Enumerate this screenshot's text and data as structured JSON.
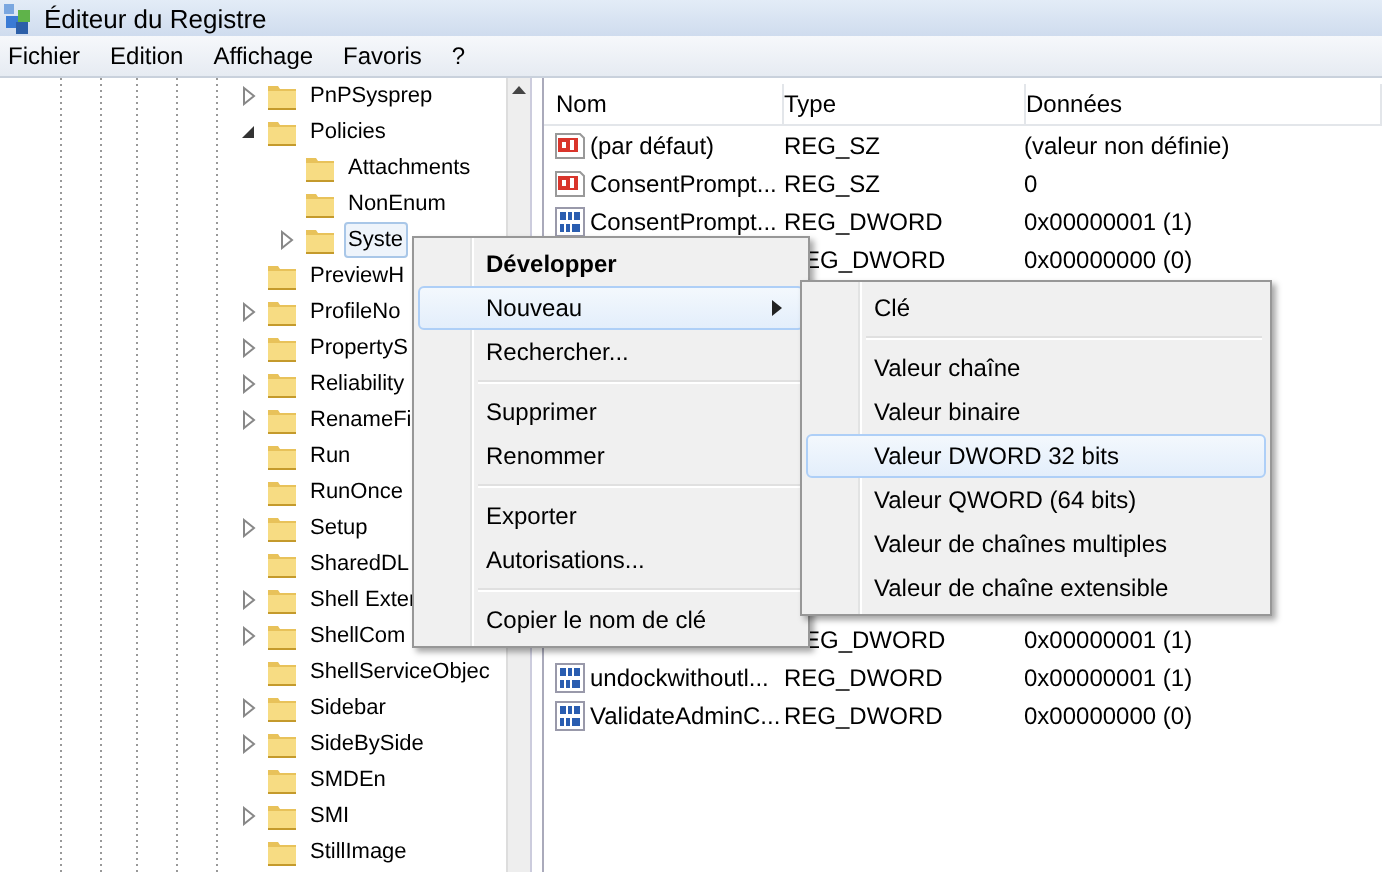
{
  "window": {
    "title": "Éditeur du Registre"
  },
  "menu_bar": [
    "Fichier",
    "Edition",
    "Affichage",
    "Favoris",
    "?"
  ],
  "tree": [
    {
      "label": "PnPSysprep",
      "expandable": true,
      "expanded": false,
      "selected": false
    },
    {
      "label": "Policies",
      "expandable": true,
      "expanded": true,
      "selected": false,
      "children": [
        {
          "label": "Attachments",
          "expandable": false,
          "selected": false
        },
        {
          "label": "NonEnum",
          "expandable": false,
          "selected": false
        },
        {
          "label": "Syste",
          "expandable": true,
          "expanded": false,
          "selected": true
        }
      ]
    },
    {
      "label": "PreviewH",
      "expandable": false,
      "selected": false
    },
    {
      "label": "ProfileNo",
      "expandable": true,
      "expanded": false,
      "selected": false
    },
    {
      "label": "PropertyS",
      "expandable": true,
      "expanded": false,
      "selected": false
    },
    {
      "label": "Reliability",
      "expandable": true,
      "expanded": false,
      "selected": false
    },
    {
      "label": "RenameFi",
      "expandable": true,
      "expanded": false,
      "selected": false
    },
    {
      "label": "Run",
      "expandable": false,
      "selected": false
    },
    {
      "label": "RunOnce",
      "expandable": false,
      "selected": false
    },
    {
      "label": "Setup",
      "expandable": true,
      "expanded": false,
      "selected": false
    },
    {
      "label": "SharedDL",
      "expandable": false,
      "selected": false
    },
    {
      "label": "Shell Exter",
      "expandable": true,
      "expanded": false,
      "selected": false
    },
    {
      "label": "ShellCom",
      "expandable": true,
      "expanded": false,
      "selected": false
    },
    {
      "label": "ShellServiceObjec",
      "expandable": false,
      "selected": false
    },
    {
      "label": "Sidebar",
      "expandable": true,
      "expanded": false,
      "selected": false
    },
    {
      "label": "SideBySide",
      "expandable": true,
      "expanded": false,
      "selected": false
    },
    {
      "label": "SMDEn",
      "expandable": false,
      "selected": false
    },
    {
      "label": "SMI",
      "expandable": true,
      "expanded": false,
      "selected": false
    },
    {
      "label": "StillImage",
      "expandable": false,
      "selected": false
    }
  ],
  "values": {
    "columns": [
      "Nom",
      "Type",
      "Données"
    ],
    "rows_top": [
      {
        "kind": "string",
        "name": "(par défaut)",
        "type": "REG_SZ",
        "data": "(valeur non définie)"
      },
      {
        "kind": "string",
        "name": "ConsentPrompt...",
        "type": "REG_SZ",
        "data": "0"
      },
      {
        "kind": "dword",
        "name": "ConsentPrompt...",
        "type": "REG_DWORD",
        "data": "0x00000001 (1)"
      },
      {
        "kind": "hidden",
        "type": "EG_DWORD",
        "data": "0x00000000 (0)"
      }
    ],
    "rows_bottom": [
      {
        "kind": "hidden",
        "type": "EG_DWORD",
        "data": "0x00000001 (1)"
      },
      {
        "kind": "dword",
        "name": "undockwithoutl...",
        "type": "REG_DWORD",
        "data": "0x00000001 (1)"
      },
      {
        "kind": "dword",
        "name": "ValidateAdminC...",
        "type": "REG_DWORD",
        "data": "0x00000000 (0)"
      }
    ]
  },
  "context_menu": [
    {
      "kind": "item",
      "label": "Développer",
      "default": true,
      "selected": false,
      "submenu": false
    },
    {
      "kind": "item",
      "label": "Nouveau",
      "default": false,
      "selected": true,
      "submenu": true
    },
    {
      "kind": "item",
      "label": "Rechercher...",
      "default": false,
      "selected": false,
      "submenu": false
    },
    {
      "kind": "separator"
    },
    {
      "kind": "item",
      "label": "Supprimer",
      "default": false,
      "selected": false,
      "submenu": false
    },
    {
      "kind": "item",
      "label": "Renommer",
      "default": false,
      "selected": false,
      "submenu": false
    },
    {
      "kind": "separator"
    },
    {
      "kind": "item",
      "label": "Exporter",
      "default": false,
      "selected": false,
      "submenu": false
    },
    {
      "kind": "item",
      "label": "Autorisations...",
      "default": false,
      "selected": false,
      "submenu": false
    },
    {
      "kind": "separator"
    },
    {
      "kind": "item",
      "label": "Copier le nom de clé",
      "default": false,
      "selected": false,
      "submenu": false
    }
  ],
  "submenu": [
    {
      "kind": "item",
      "label": "Clé",
      "selected": false
    },
    {
      "kind": "separator"
    },
    {
      "kind": "item",
      "label": "Valeur chaîne",
      "selected": false
    },
    {
      "kind": "item",
      "label": "Valeur binaire",
      "selected": false
    },
    {
      "kind": "item",
      "label": "Valeur DWORD 32 bits",
      "selected": true
    },
    {
      "kind": "item",
      "label": "Valeur QWORD (64 bits)",
      "selected": false
    },
    {
      "kind": "item",
      "label": "Valeur de chaînes multiples",
      "selected": false
    },
    {
      "kind": "item",
      "label": "Valeur de chaîne extensible",
      "selected": false
    }
  ]
}
